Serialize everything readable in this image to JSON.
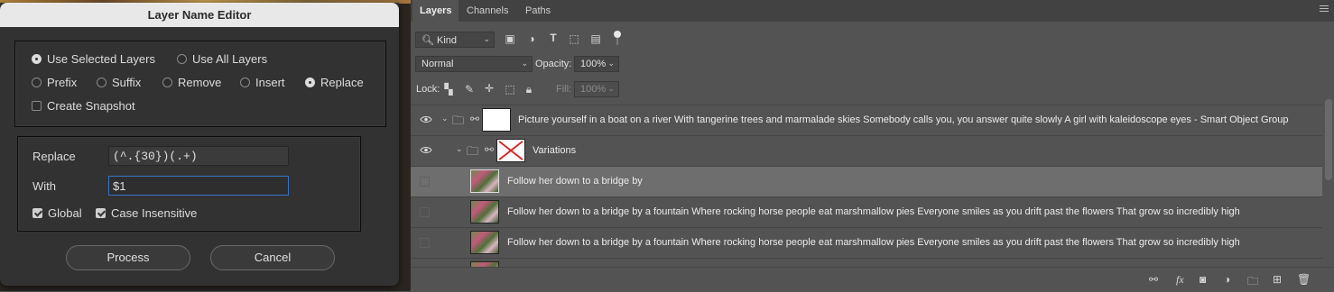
{
  "dialog": {
    "title": "Layer Name Editor",
    "scope": {
      "use_selected": "Use Selected Layers",
      "use_all": "Use All Layers",
      "selected": "use_selected"
    },
    "modes": {
      "prefix": "Prefix",
      "suffix": "Suffix",
      "remove": "Remove",
      "insert": "Insert",
      "replace": "Replace",
      "selected": "replace"
    },
    "snapshot": {
      "label": "Create Snapshot",
      "checked": false
    },
    "replace_label": "Replace",
    "replace_value": "(^.{30})(.+)",
    "with_label": "With",
    "with_value": "$1",
    "global": {
      "label": "Global",
      "checked": true
    },
    "case_insensitive": {
      "label": "Case Insensitive",
      "checked": true
    },
    "process_label": "Process",
    "cancel_label": "Cancel"
  },
  "panel": {
    "tabs": [
      "Layers",
      "Channels",
      "Paths"
    ],
    "active_tab": "Layers",
    "filter_kind": "Kind",
    "blend_mode": "Normal",
    "opacity_label": "Opacity:",
    "opacity_value": "100%",
    "lock_label": "Lock:",
    "fill_label": "Fill:",
    "fill_value": "100%",
    "layers": [
      {
        "name": "Picture yourself in a boat on a river With tangerine trees and marmalade skies Somebody calls you, you answer quite slowly A girl with kaleidoscope eyes - Smart Object Group",
        "type": "group",
        "visible": true
      },
      {
        "name": "Variations",
        "type": "group",
        "visible": true
      },
      {
        "name": "Follow her down to a bridge by",
        "type": "image",
        "selected": true
      },
      {
        "name": "Follow her down to a bridge by a fountain Where rocking horse people eat marshmallow pies Everyone smiles as you drift past the flowers That grow so incredibly high",
        "type": "image"
      },
      {
        "name": "Follow her down to a bridge by a fountain Where rocking horse people eat marshmallow pies Everyone smiles as you drift past the flowers That grow so incredibly high",
        "type": "image"
      }
    ]
  },
  "colors": {
    "panel_bg": "#535353",
    "selected_row": "#6e6e6e",
    "focus_border": "#3b73c6",
    "no_thumb_x": "#d22"
  }
}
